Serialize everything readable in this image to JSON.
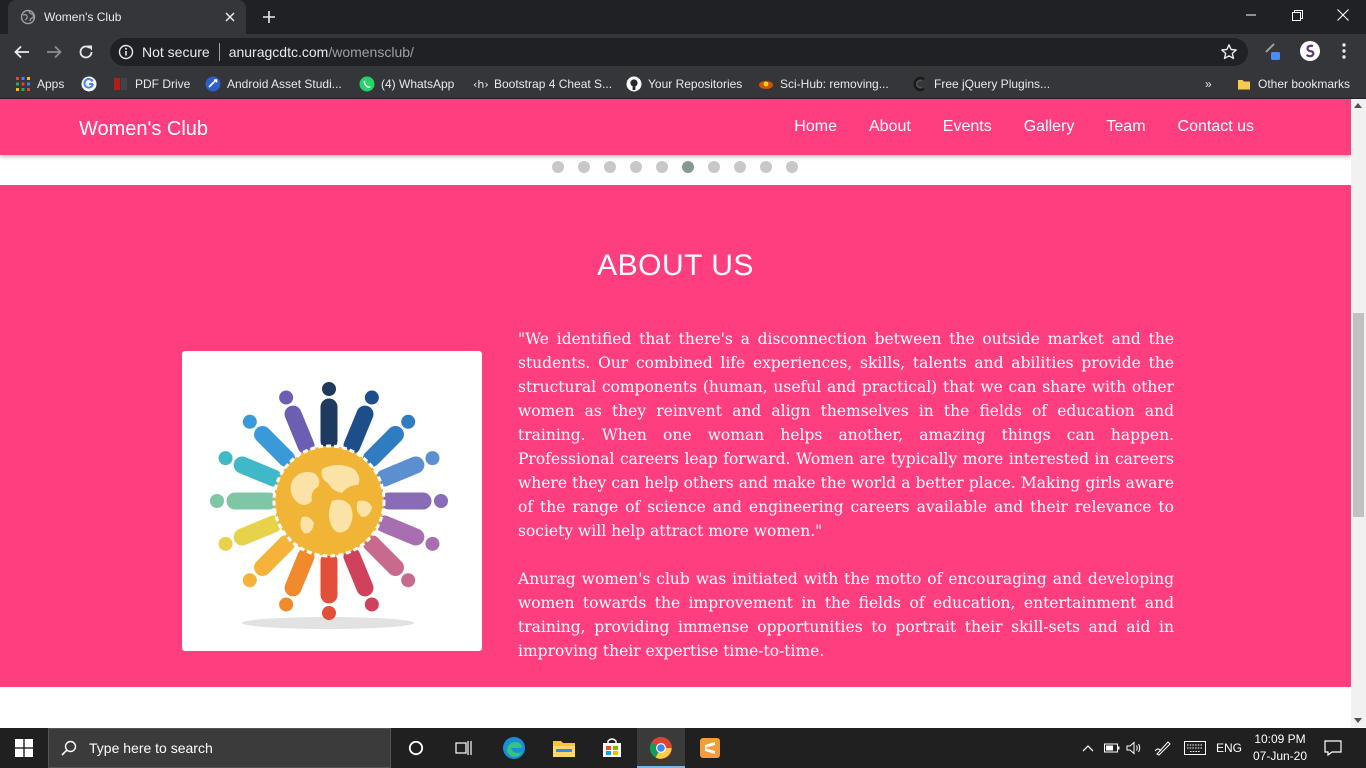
{
  "browser": {
    "tab_title": "Women's Club",
    "address": {
      "security": "Not secure",
      "host": "anuragcdtc.com",
      "path": "/womensclub/"
    },
    "bookmarks": [
      "Apps",
      "PDF Drive",
      "Android Asset Studi...",
      "(4) WhatsApp",
      "Bootstrap 4 Cheat S...",
      "Your Repositories",
      "Sci-Hub: removing...",
      "Free jQuery Plugins..."
    ],
    "bookmarks_overflow": "»",
    "other_bookmarks": "Other bookmarks"
  },
  "site": {
    "brand": "Women's Club",
    "menu": [
      "Home",
      "About",
      "Events",
      "Gallery",
      "Team",
      "Contact us"
    ],
    "carousel": {
      "total_slides": 10,
      "active_index": 5
    },
    "about": {
      "heading": "ABOUT US",
      "paragraphs": [
        "\"We identified that there's a disconnection between the outside market and the students. Our combined life experiences, skills, talents and abilities provide the structural components (human, useful and practical) that we can share with other women as they reinvent and align themselves in the fields of education and training. When one woman helps another, amazing things can happen. Professional careers leap forward. Women are typically more interested in careers where they can help others and make the world a better place. Making girls aware of the range of science and engineering careers available and their relevance to society will help attract more women.\"",
        "Anurag women's club was initiated with the motto of encouraging and developing women towards the improvement in the fields of education, entertainment and training, providing immense opportunities to portrait their skill-sets and aid in improving their expertise time-to-time."
      ]
    }
  },
  "taskbar": {
    "search_placeholder": "Type here to search",
    "language": "ENG",
    "time": "10:09 PM",
    "date": "07-Jun-20"
  },
  "colors": {
    "accent": "#ff3e7f",
    "chrome_dark": "#202124",
    "chrome_mid": "#35363a"
  }
}
